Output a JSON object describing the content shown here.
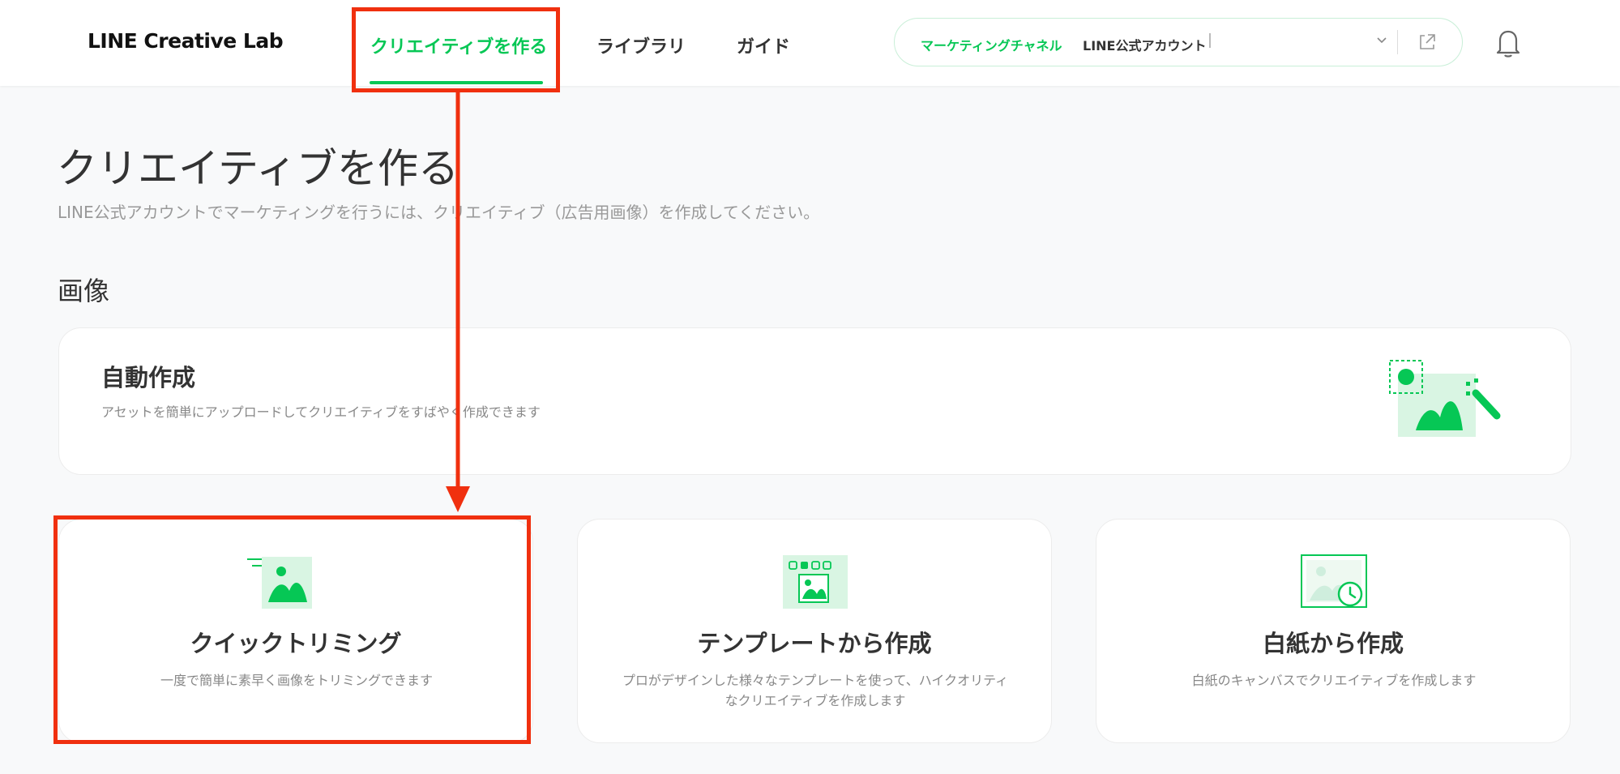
{
  "header": {
    "logo": "LINE Creative Lab",
    "nav": [
      {
        "label": "クリエイティブを作る",
        "active": true
      },
      {
        "label": "ライブラリ",
        "active": false
      },
      {
        "label": "ガイド",
        "active": false
      }
    ],
    "channel": {
      "label": "マーケティングチャネル",
      "name": "LINE公式アカウント"
    }
  },
  "main": {
    "title": "クリエイティブを作る",
    "subtitle": "LINE公式アカウントでマーケティングを行うには、クリエイティブ（広告用画像）を作成してください。",
    "section_title": "画像",
    "auto_card": {
      "title": "自動作成",
      "desc": "アセットを簡単にアップロードしてクリエイティブをすばやく作成できます",
      "icon": "auto-create-icon"
    },
    "cards": [
      {
        "title": "クイックトリミング",
        "desc": "一度で簡単に素早く画像をトリミングできます",
        "icon": "quick-trim-icon"
      },
      {
        "title": "テンプレートから作成",
        "desc": "プロがデザインした様々なテンプレートを使って、ハイクオリティなクリエイティブを作成します",
        "icon": "template-icon"
      },
      {
        "title": "白紙から作成",
        "desc": "白紙のキャンバスでクリエイティブを作成します",
        "icon": "blank-canvas-icon"
      }
    ]
  },
  "colors": {
    "accent": "#06c755",
    "annotation": "#f0300f"
  }
}
